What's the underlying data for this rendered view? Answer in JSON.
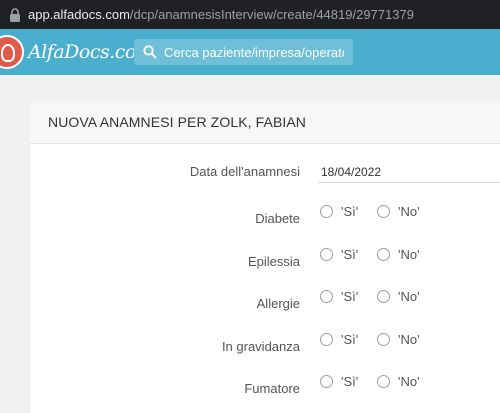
{
  "browser": {
    "url_host": "app.alfadocs.com",
    "url_path": "/dcp/anamnesisInterview/create/44819/29771379"
  },
  "header": {
    "brand": "AlfaDocs.com",
    "search_placeholder": "Cerca paziente/impresa/operatore"
  },
  "form": {
    "title": "NUOVA ANAMNESI PER ZOLK, FABIAN",
    "date_label": "Data dell'anamnesi",
    "date_value": "18/04/2022",
    "option_yes": "'Sì'",
    "option_no": "'No'",
    "questions": [
      {
        "label": "Diabete"
      },
      {
        "label": "Epilessia"
      },
      {
        "label": "Allergie"
      },
      {
        "label": "In gravidanza"
      },
      {
        "label": "Fumatore"
      }
    ]
  },
  "colors": {
    "header_bg": "#4aaece",
    "logo_red": "#e05a4b"
  }
}
